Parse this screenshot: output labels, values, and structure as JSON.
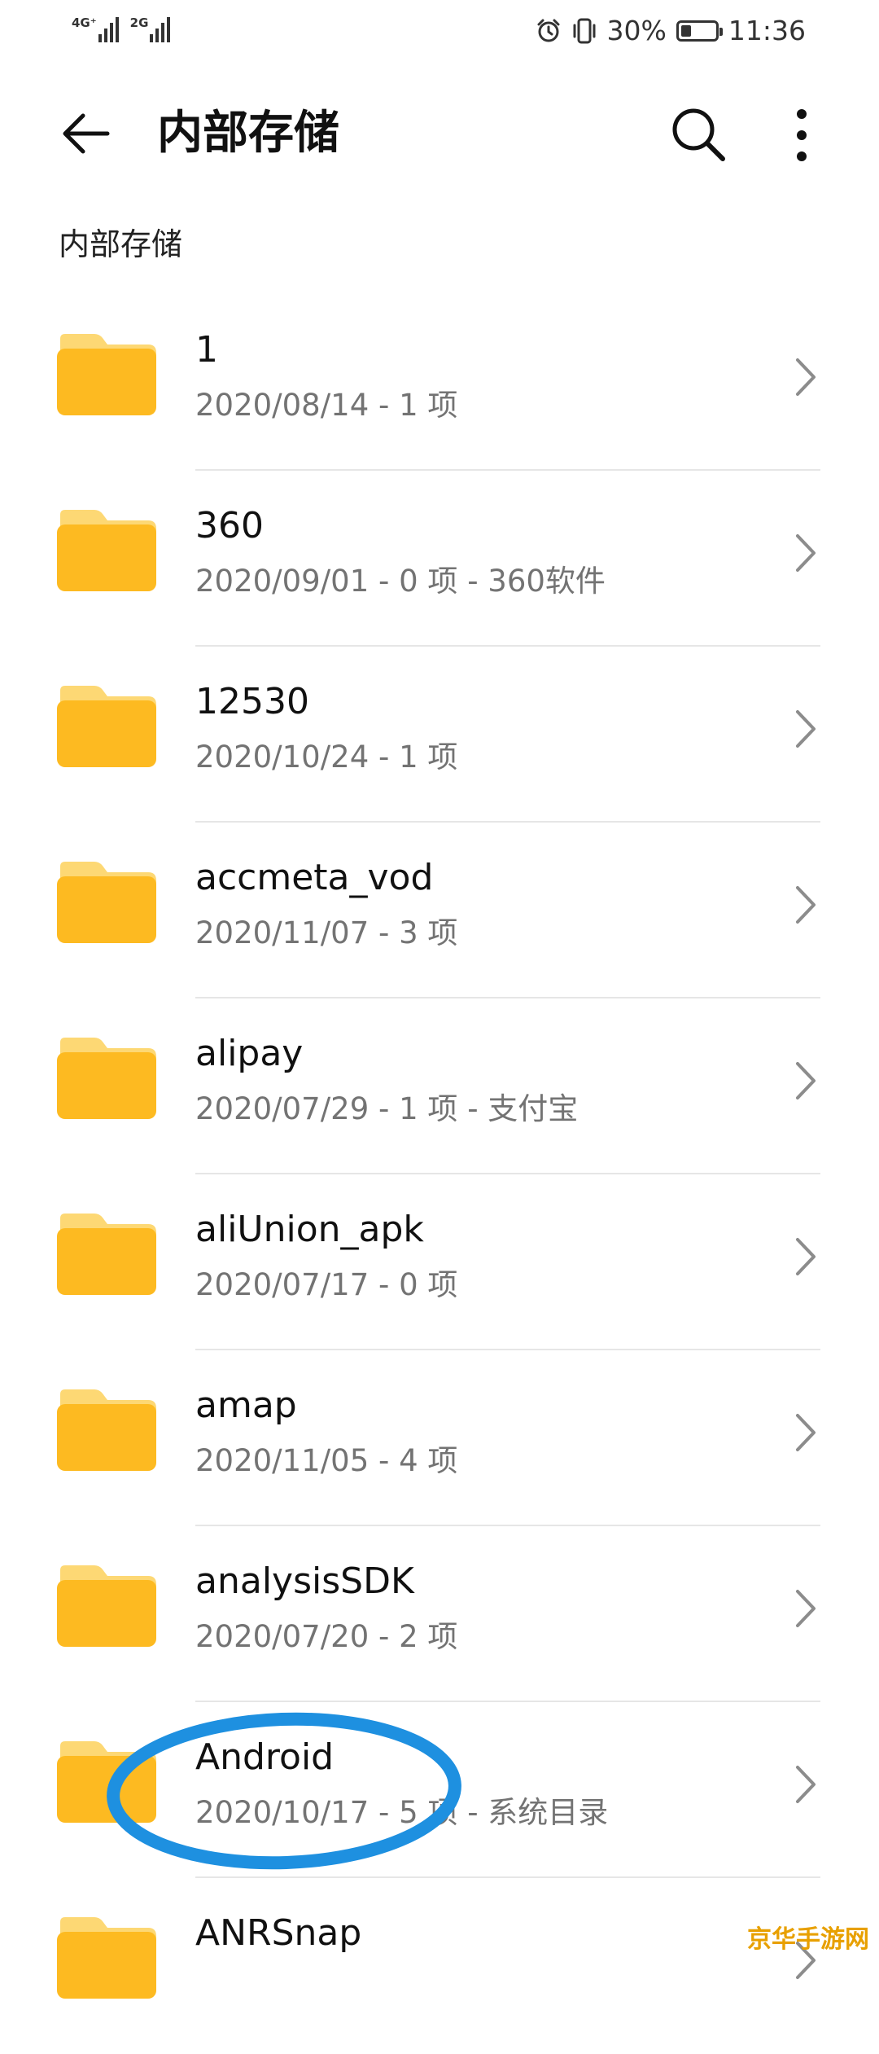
{
  "status_bar": {
    "network_1": "4G⁺",
    "network_2": "2G",
    "battery_percent": "30%",
    "battery_level": 0.3,
    "time": "11:36",
    "icons": [
      "alarm-icon",
      "vibrate-icon",
      "battery-icon"
    ]
  },
  "app_bar": {
    "title": "内部存储",
    "icons": [
      "back-arrow-icon",
      "search-icon",
      "more-vertical-icon"
    ]
  },
  "breadcrumb": "内部存储",
  "colors": {
    "folder": "#FDBA21",
    "folder_tab": "#FDD874",
    "annotation": "#1E90E0",
    "watermark": "#E8A000"
  },
  "files": [
    {
      "name": "1",
      "meta": "2020/08/14 - 1 项"
    },
    {
      "name": "360",
      "meta": "2020/09/01 - 0 项 - 360软件"
    },
    {
      "name": "12530",
      "meta": "2020/10/24 - 1 项"
    },
    {
      "name": "accmeta_vod",
      "meta": "2020/11/07 - 3 项"
    },
    {
      "name": "alipay",
      "meta": "2020/07/29 - 1 项 - 支付宝"
    },
    {
      "name": "aliUnion_apk",
      "meta": "2020/07/17 - 0 项"
    },
    {
      "name": "amap",
      "meta": "2020/11/05 - 4 项"
    },
    {
      "name": "analysisSDK",
      "meta": "2020/07/20 - 2 项"
    },
    {
      "name": "Android",
      "meta": "2020/10/17 - 5 项 - 系统目录"
    },
    {
      "name": "ANRSnap",
      "meta": ""
    }
  ],
  "watermark": "京华手游网"
}
